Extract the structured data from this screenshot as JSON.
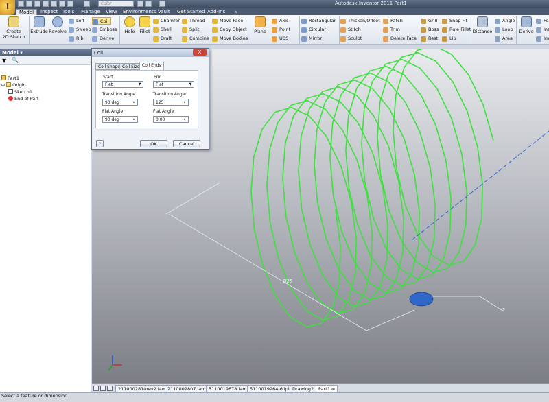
{
  "app": {
    "logo_letter": "I",
    "title": "Autodesk Inventor 2011    Part1",
    "color_placeholder": "Color"
  },
  "tabs": [
    "Model",
    "Inspect",
    "Tools",
    "Manage",
    "View",
    "Environments",
    "Vault",
    "Get Started",
    "Add-Ins"
  ],
  "ribbon": {
    "sketch": {
      "label": "Create\n2D Sketch"
    },
    "create_big": [
      "Extrude",
      "Revolve"
    ],
    "create_small": [
      "Loft",
      "Sweep",
      "Rib",
      "Coil",
      "Emboss",
      "Derive"
    ],
    "modify_big": [
      "Hole",
      "Fillet"
    ],
    "modify_small": [
      "Chamfer",
      "Shell",
      "Draft",
      "Thread",
      "Split",
      "Combine",
      "Move Face",
      "Copy Object",
      "Move Bodies"
    ],
    "workfeat_big": "Plane",
    "workfeat_small": [
      "Axis",
      "Point",
      "UCS"
    ],
    "pattern_small": [
      "Rectangular",
      "Circular",
      "Mirror"
    ],
    "surface_small": [
      "Thicken/Offset",
      "Stitch",
      "Sculpt",
      "Patch",
      "Trim",
      "Delete Face"
    ],
    "plastic_small": [
      "Grill",
      "Boss",
      "Rest",
      "Snap Fit",
      "Rule Fillet",
      "Lip"
    ],
    "measure_big": "Distance",
    "measure_small": [
      "Angle",
      "Loop",
      "Area"
    ],
    "derive_big": "Derive",
    "insert_small": [
      "Fea",
      "Ins",
      "Imp"
    ]
  },
  "browser": {
    "header": "Model ▾",
    "tree": [
      "Part1",
      "Origin",
      "Sketch1",
      "End of Part"
    ]
  },
  "dialog": {
    "title": "Coil",
    "close": "X",
    "tabs": [
      "Coil Shape",
      "Coil Size",
      "Coil Ends"
    ],
    "start_label": "Start",
    "start_value": "Flat",
    "start_transition_label": "Transition Angle",
    "start_transition_value": "90 deg",
    "start_flat_label": "Flat Angle",
    "start_flat_value": "90 deg",
    "end_label": "End",
    "end_value": "Flat",
    "end_transition_label": "Transition Angle",
    "end_transition_value": "125",
    "end_flat_label": "Flat Angle",
    "end_flat_value": "0.00",
    "help": "?",
    "ok": "OK",
    "cancel": "Cancel"
  },
  "viewport": {
    "dim_diameter": "Ø25",
    "dim_pitch": "2",
    "coil_color": "#3ee03e",
    "axis_color": "#2f5fd0"
  },
  "doc_tabs": [
    "2110002810rev2.iam",
    "2110002807.iam",
    "5110019678.iam",
    "5110019264-6.ipt",
    "Drawing2",
    "Part1"
  ],
  "status": "Select a feature or dimension"
}
